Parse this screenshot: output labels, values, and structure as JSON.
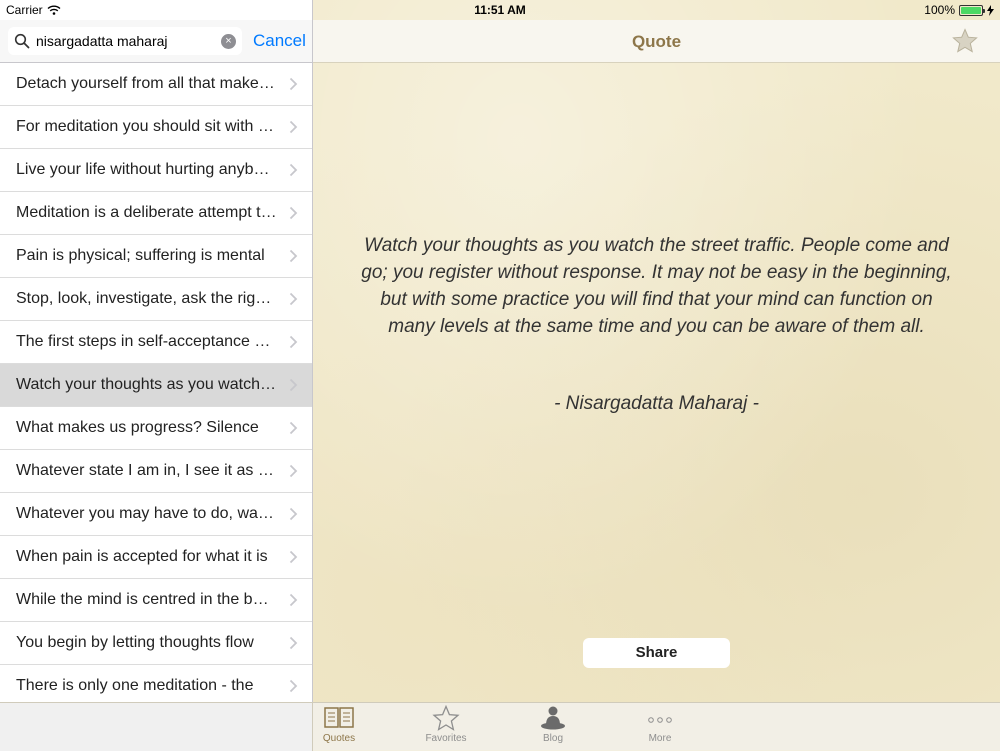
{
  "status_bar": {
    "carrier": "Carrier",
    "time": "11:51 AM",
    "battery": "100%"
  },
  "search": {
    "query": "nisargadatta maharaj",
    "cancel_label": "Cancel",
    "clear_symbol": "×"
  },
  "quotes_list": [
    "Detach yourself from all that makes you feel",
    "For meditation you should sit with your mind",
    "Live your life without hurting anybody",
    "Meditation is a deliberate attempt to pierce",
    "Pain is physical; suffering is mental",
    "Stop, look, investigate, ask the right question",
    "The first steps in self-acceptance are not",
    "Watch your thoughts as you watch the street",
    "What makes us progress? Silence",
    "Whatever state I am in, I see it as a state",
    "Whatever you may have to do, watch it",
    "When pain is accepted for what it is",
    "While the mind is centred in the body",
    "You begin by letting thoughts flow",
    "There is only one meditation - the"
  ],
  "selected_index": 7,
  "nav": {
    "title": "Quote"
  },
  "quote": {
    "text": "Watch your thoughts as you watch the street traffic. People come and go; you register without response. It may not be easy in the beginning, but with some practice you will find that your mind can function on many levels at the same time and you can be aware of them all.",
    "author": "-  Nisargadatta Maharaj  -"
  },
  "share_label": "Share",
  "tabs": [
    {
      "label": "Quotes",
      "icon": "book-icon",
      "active": true
    },
    {
      "label": "Favorites",
      "icon": "star-icon",
      "active": false
    },
    {
      "label": "Blog",
      "icon": "meditating-person-icon",
      "active": false
    },
    {
      "label": "More",
      "icon": "more-dots-icon",
      "active": false
    }
  ],
  "colors": {
    "accent": "#8d7649",
    "link": "#007aff",
    "battery": "#4cd964"
  }
}
